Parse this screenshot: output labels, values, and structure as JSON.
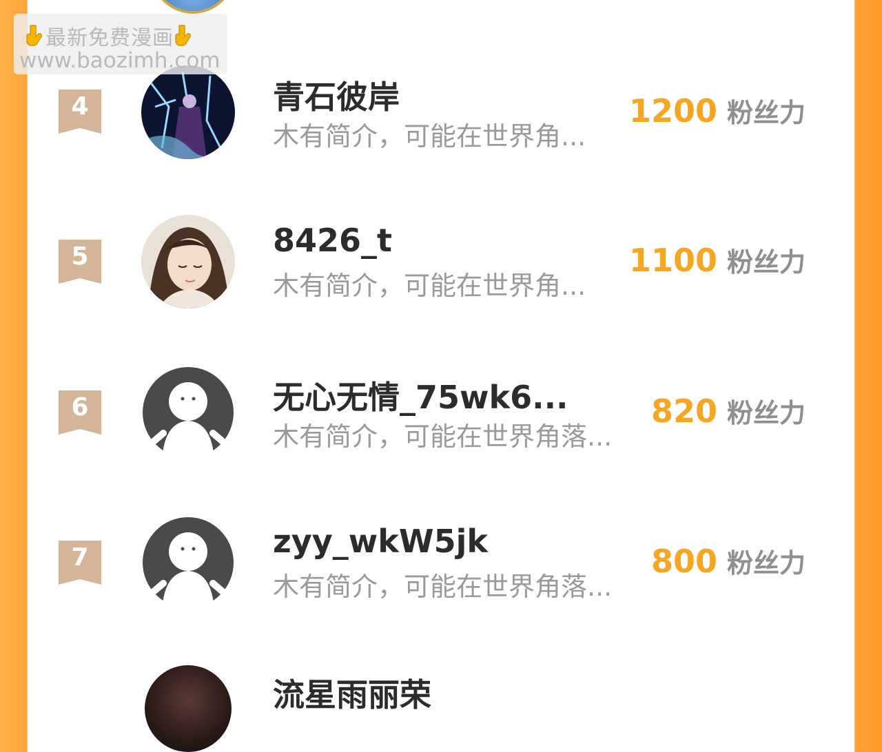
{
  "watermark": {
    "line1": "最新免费漫画",
    "line2": "www.baozimh.com"
  },
  "score_unit": "粉丝力",
  "entries": [
    {
      "rank": "4",
      "name": "青石彼岸",
      "bio": "木有简介，可能在世界角...",
      "score": "1200"
    },
    {
      "rank": "5",
      "name": "8426_t",
      "bio": "木有简介，可能在世界角...",
      "score": "1100"
    },
    {
      "rank": "6",
      "name": "无心无情_75wk6...",
      "bio": "木有简介，可能在世界角落...",
      "score": "820"
    },
    {
      "rank": "7",
      "name": "zyy_wkW5jk",
      "bio": "木有简介，可能在世界角落...",
      "score": "800"
    }
  ],
  "next_entry": {
    "name": "流星雨丽荣"
  },
  "colors": {
    "accent": "#f5a623",
    "badge": "#d4b59a",
    "side": "#ffa53a"
  }
}
